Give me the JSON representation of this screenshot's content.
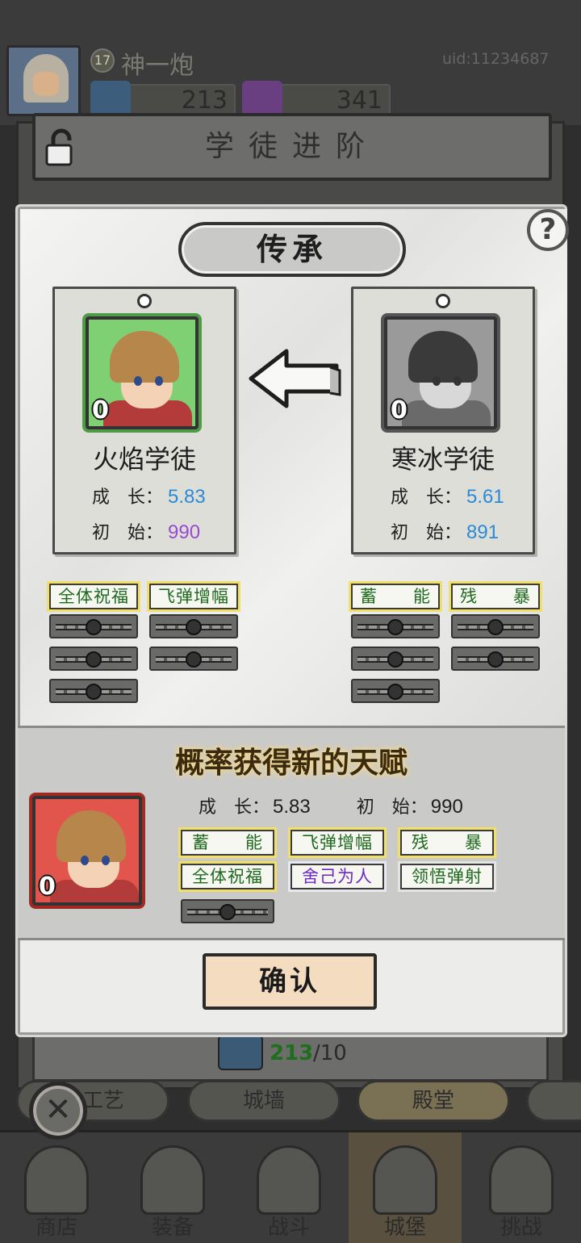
{
  "player": {
    "level": "17",
    "name": "神一炮",
    "uid": "uid:11234687",
    "books": "213",
    "gems": "341"
  },
  "header": {
    "title": "学徒进阶"
  },
  "dialog": {
    "title": "传承",
    "help": "?",
    "confirm": "确认"
  },
  "labels": {
    "growth": "成　长：",
    "initial": "初　始："
  },
  "left": {
    "name": "火焰学徒",
    "stars": "0",
    "growth": "5.83",
    "initial": "990",
    "skills": [
      "全体祝福",
      "飞弹增幅"
    ]
  },
  "right": {
    "name": "寒冰学徒",
    "stars": "0",
    "growth": "5.61",
    "initial": "891",
    "skills": [
      "蓄　　能",
      "残　　暴"
    ]
  },
  "result": {
    "title": "概率获得新的天赋",
    "stars": "0",
    "growth": "5.83",
    "initial": "990",
    "skills": [
      "蓄　　能",
      "飞弹增幅",
      "残　　暴",
      "全体祝福",
      "舍己为人",
      "领悟弹射"
    ]
  },
  "tokens": {
    "current": "213",
    "total": "/10"
  },
  "subtabs": [
    "手工艺",
    "城墙",
    "殿堂"
  ],
  "nav": [
    "商店",
    "装备",
    "战斗",
    "城堡",
    "挑战"
  ],
  "colors": {
    "growth_value": "#2a8ad8",
    "initial_value_purple": "#9a4ad0",
    "skill_green": "#1e6a1e",
    "skill_purple": "#6b2ac0"
  }
}
